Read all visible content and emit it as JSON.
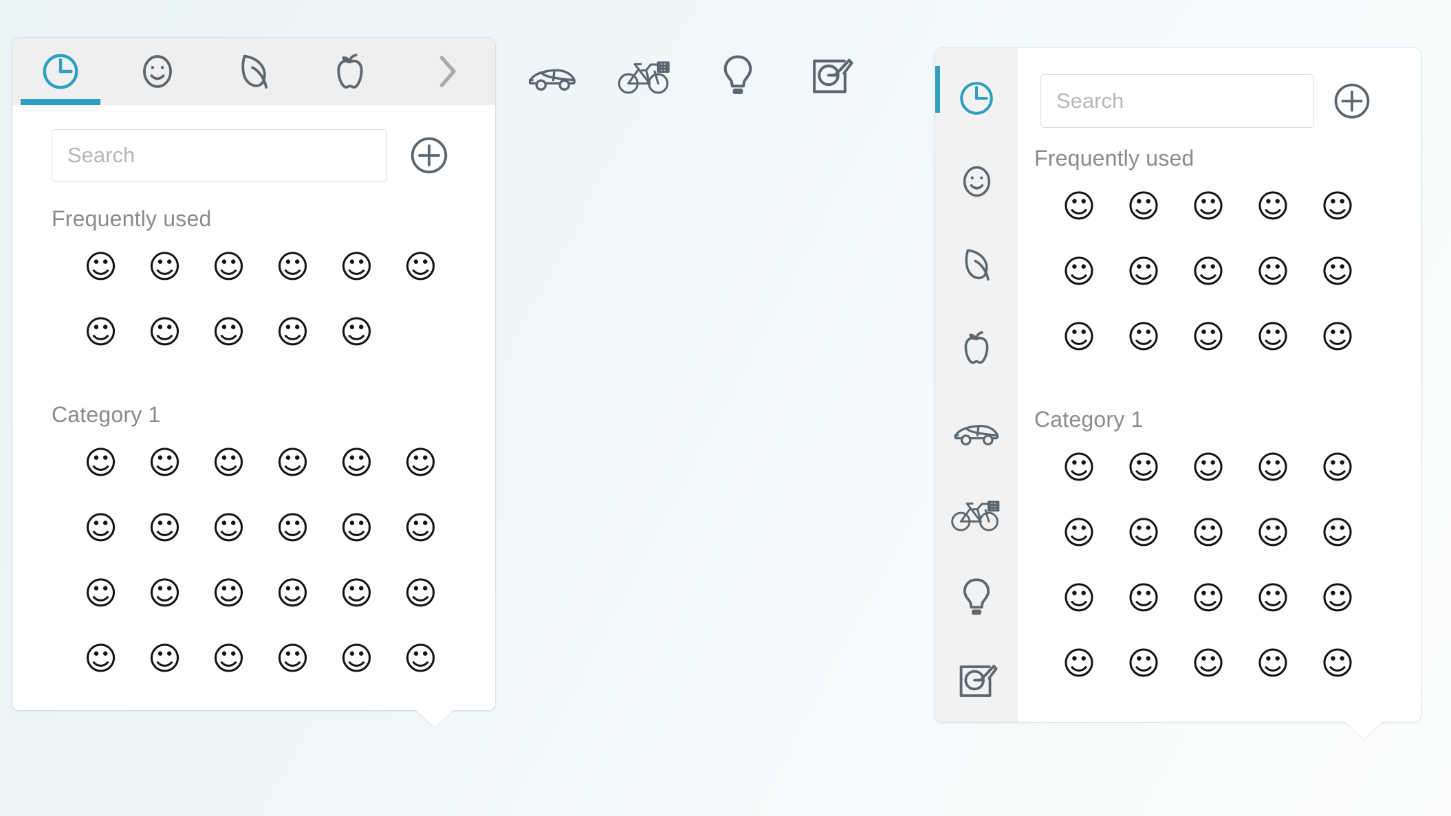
{
  "theme": {
    "accent": "#2e9fc0",
    "tabbar_bg": "#efefef",
    "sidebar_bg": "#f2f2f2",
    "panel_bg": "#ffffff",
    "page_bg": "#eef6f8",
    "icon_stroke": "#5b6770",
    "label_color": "#8b8b8b",
    "placeholder_color": "#b6b6b6"
  },
  "left_panel": {
    "tabs": [
      {
        "id": "clock",
        "icon": "clock-icon",
        "active": true,
        "label": "Recently used"
      },
      {
        "id": "smiley",
        "icon": "smiley-icon",
        "active": false,
        "label": "Smileys"
      },
      {
        "id": "leaf",
        "icon": "leaf-icon",
        "active": false,
        "label": "Nature"
      },
      {
        "id": "apple",
        "icon": "apple-icon",
        "active": false,
        "label": "Food"
      },
      {
        "id": "more",
        "icon": "chevron-right-icon",
        "active": false,
        "label": "More"
      }
    ],
    "search": {
      "value": "",
      "placeholder": "Search"
    },
    "add_button": {
      "icon": "plus-circle-icon",
      "label": "Add"
    },
    "sections": [
      {
        "title": "Frequently used",
        "rows": [
          6,
          5
        ],
        "emoji": "☺"
      },
      {
        "title": "Category 1",
        "rows": [
          6,
          6,
          6,
          6
        ],
        "emoji": "☺"
      }
    ]
  },
  "overflow_icons": [
    {
      "id": "car",
      "icon": "car-icon",
      "label": "Travel"
    },
    {
      "id": "bicycle",
      "icon": "bicycle-icon",
      "label": "Activity"
    },
    {
      "id": "bulb",
      "icon": "bulb-icon",
      "label": "Objects"
    },
    {
      "id": "draw",
      "icon": "draw-icon",
      "label": "Custom"
    }
  ],
  "right_panel": {
    "sidebar_items": [
      {
        "id": "clock",
        "icon": "clock-icon",
        "active": true,
        "label": "Recently used"
      },
      {
        "id": "smiley",
        "icon": "smiley-icon",
        "active": false,
        "label": "Smileys"
      },
      {
        "id": "leaf",
        "icon": "leaf-icon",
        "active": false,
        "label": "Nature"
      },
      {
        "id": "apple",
        "icon": "apple-icon",
        "active": false,
        "label": "Food"
      },
      {
        "id": "car",
        "icon": "car-icon",
        "active": false,
        "label": "Travel"
      },
      {
        "id": "bicycle",
        "icon": "bicycle-icon",
        "active": false,
        "label": "Activity"
      },
      {
        "id": "bulb",
        "icon": "bulb-icon",
        "active": false,
        "label": "Objects"
      },
      {
        "id": "draw",
        "icon": "draw-icon",
        "active": false,
        "label": "Custom"
      }
    ],
    "search": {
      "value": "",
      "placeholder": "Search"
    },
    "add_button": {
      "icon": "plus-circle-icon",
      "label": "Add"
    },
    "sections": [
      {
        "title": "Frequently used",
        "rows": [
          5,
          5,
          5
        ],
        "emoji": "☺"
      },
      {
        "title": "Category 1",
        "rows": [
          5,
          5,
          5,
          5
        ],
        "emoji": "☺"
      }
    ]
  }
}
